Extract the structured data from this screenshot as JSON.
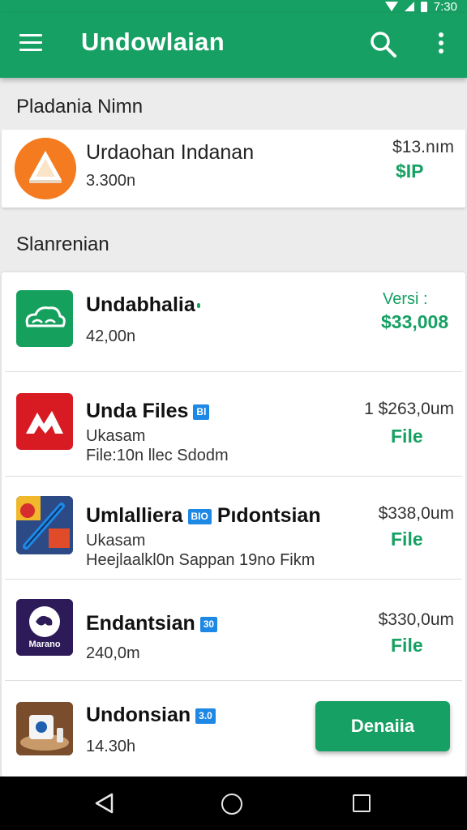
{
  "status_bar": {
    "time": "7:30"
  },
  "app_bar": {
    "title": "Undowlaian"
  },
  "featured": {
    "header": "Pladania Nimn",
    "item": {
      "name": "Urdaohan Indanan",
      "size": "3.300n",
      "price": "$13.nım",
      "action": "$IP"
    }
  },
  "list": {
    "header": "Slanrenian",
    "items": [
      {
        "name": "Undabhalia",
        "badge": "",
        "size": "42,00n",
        "detail": "",
        "price": "Versi :",
        "action": "$33,008"
      },
      {
        "name": "Unda Files",
        "badge": "Bl",
        "size": "Ukasam",
        "detail": "File:10n llec Sdodm",
        "price": "1 $263,0um",
        "action": "File"
      },
      {
        "name": "Umlalliera",
        "badge": "BIO",
        "name2": "Pıdontsian",
        "size": "Ukasam",
        "detail": "Heejlaalkl0n Sappan 19no Fikm",
        "price": "$338,0um",
        "action": "File"
      },
      {
        "name": "Endantsian",
        "badge": "30",
        "size": "240,0m",
        "detail": "",
        "price": "$330,0um",
        "action": "File"
      },
      {
        "name": "Undonsian",
        "badge": "3.0",
        "size": "14.30h",
        "detail": "",
        "price": "",
        "action": ""
      }
    ],
    "icon_labels": {
      "item4": "Marano"
    }
  },
  "fab": {
    "label": "Denaiia"
  },
  "colors": {
    "primary": "#17a063",
    "badge_blue": "#1e88e5",
    "nav": "#000000"
  },
  "icons": [
    "menu-icon",
    "search-icon",
    "more-vert-icon",
    "back-icon",
    "home-icon",
    "recents-icon"
  ]
}
